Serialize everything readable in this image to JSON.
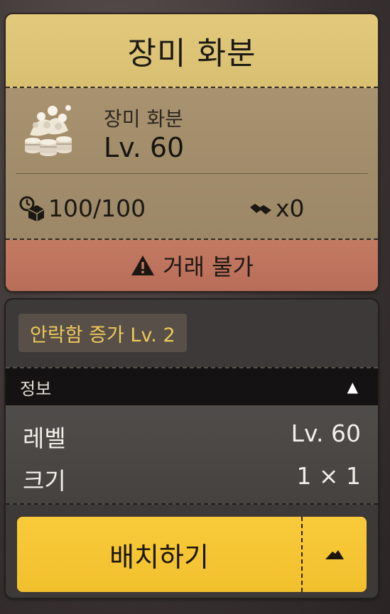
{
  "item": {
    "title": "장미 화분",
    "name": "장미 화분",
    "level": "Lv. 60",
    "icon": "rose-pot-coins-icon",
    "durability": "100/100",
    "count": "x0",
    "trade_status": "거래 불가"
  },
  "panel": {
    "buff": "안락함 증가 Lv. 2",
    "section_title": "정보",
    "rows": [
      {
        "label": "레벨",
        "value": "Lv. 60"
      },
      {
        "label": "크기",
        "value": "1 × 1"
      }
    ],
    "place_label": "배치하기"
  },
  "colors": {
    "title_bg": "#d8bf71",
    "card_body": "#a18d6c",
    "trade_bar": "#b86d58",
    "buff_text": "#eec85a",
    "action_yellow": "#f4c332"
  }
}
